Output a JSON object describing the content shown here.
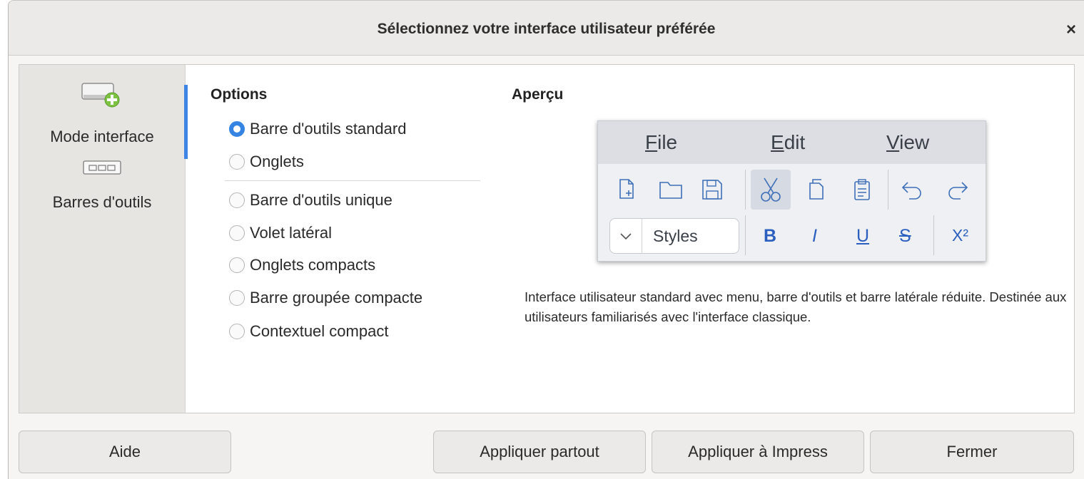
{
  "dialog": {
    "title": "Sélectionnez votre interface utilisateur préférée",
    "close_glyph": "×"
  },
  "sidebar": {
    "items": [
      {
        "label": "Mode interface",
        "icon": "interface-mode-icon",
        "selected": true
      },
      {
        "label": "Barres d'outils",
        "icon": "toolbar-icon",
        "selected": false
      }
    ]
  },
  "options": {
    "title": "Options",
    "items": [
      {
        "label": "Barre d'outils standard",
        "checked": true
      },
      {
        "label": "Onglets",
        "checked": false
      },
      {
        "label": "Barre d'outils unique",
        "checked": false
      },
      {
        "label": "Volet latéral",
        "checked": false
      },
      {
        "label": "Onglets compacts",
        "checked": false
      },
      {
        "label": "Barre groupée compacte",
        "checked": false
      },
      {
        "label": "Contextuel compact",
        "checked": false
      }
    ]
  },
  "preview": {
    "title": "Aperçu",
    "menus": [
      {
        "label": "File",
        "first": "F",
        "rest": "ile"
      },
      {
        "label": "Edit",
        "first": "E",
        "rest": "dit"
      },
      {
        "label": "View",
        "first": "V",
        "rest": "iew"
      }
    ],
    "style_box": "Styles",
    "format_labels": {
      "bold": "B",
      "italic": "I",
      "underline": "U",
      "strike": "S",
      "superscript": "X²"
    },
    "description": "Interface utilisateur standard avec menu, barre d'outils et barre latérale réduite. Destinée aux utilisateurs familiarisés avec l'interface classique."
  },
  "buttons": {
    "help": "Aide",
    "apply_all": "Appliquer partout",
    "apply_impress": "Appliquer à Impress",
    "close": "Fermer"
  },
  "colors": {
    "accent": "#3584e4",
    "preview_icon": "#3d6fb8"
  }
}
